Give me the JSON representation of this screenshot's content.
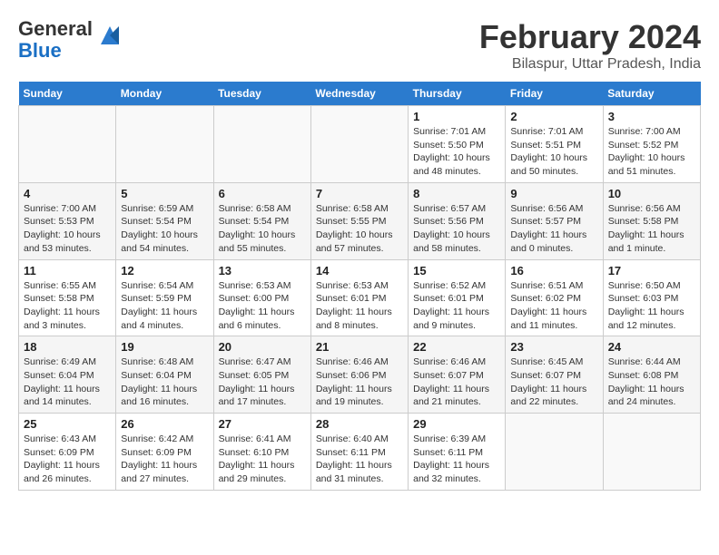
{
  "logo": {
    "line1": "General",
    "line2": "Blue"
  },
  "title": "February 2024",
  "location": "Bilaspur, Uttar Pradesh, India",
  "days_of_week": [
    "Sunday",
    "Monday",
    "Tuesday",
    "Wednesday",
    "Thursday",
    "Friday",
    "Saturday"
  ],
  "weeks": [
    [
      {
        "day": "",
        "empty": true
      },
      {
        "day": "",
        "empty": true
      },
      {
        "day": "",
        "empty": true
      },
      {
        "day": "",
        "empty": true
      },
      {
        "day": "1",
        "sunrise": "7:01 AM",
        "sunset": "5:50 PM",
        "daylight": "10 hours and 48 minutes."
      },
      {
        "day": "2",
        "sunrise": "7:01 AM",
        "sunset": "5:51 PM",
        "daylight": "10 hours and 50 minutes."
      },
      {
        "day": "3",
        "sunrise": "7:00 AM",
        "sunset": "5:52 PM",
        "daylight": "10 hours and 51 minutes."
      }
    ],
    [
      {
        "day": "4",
        "sunrise": "7:00 AM",
        "sunset": "5:53 PM",
        "daylight": "10 hours and 53 minutes."
      },
      {
        "day": "5",
        "sunrise": "6:59 AM",
        "sunset": "5:54 PM",
        "daylight": "10 hours and 54 minutes."
      },
      {
        "day": "6",
        "sunrise": "6:58 AM",
        "sunset": "5:54 PM",
        "daylight": "10 hours and 55 minutes."
      },
      {
        "day": "7",
        "sunrise": "6:58 AM",
        "sunset": "5:55 PM",
        "daylight": "10 hours and 57 minutes."
      },
      {
        "day": "8",
        "sunrise": "6:57 AM",
        "sunset": "5:56 PM",
        "daylight": "10 hours and 58 minutes."
      },
      {
        "day": "9",
        "sunrise": "6:56 AM",
        "sunset": "5:57 PM",
        "daylight": "11 hours and 0 minutes."
      },
      {
        "day": "10",
        "sunrise": "6:56 AM",
        "sunset": "5:58 PM",
        "daylight": "11 hours and 1 minute."
      }
    ],
    [
      {
        "day": "11",
        "sunrise": "6:55 AM",
        "sunset": "5:58 PM",
        "daylight": "11 hours and 3 minutes."
      },
      {
        "day": "12",
        "sunrise": "6:54 AM",
        "sunset": "5:59 PM",
        "daylight": "11 hours and 4 minutes."
      },
      {
        "day": "13",
        "sunrise": "6:53 AM",
        "sunset": "6:00 PM",
        "daylight": "11 hours and 6 minutes."
      },
      {
        "day": "14",
        "sunrise": "6:53 AM",
        "sunset": "6:01 PM",
        "daylight": "11 hours and 8 minutes."
      },
      {
        "day": "15",
        "sunrise": "6:52 AM",
        "sunset": "6:01 PM",
        "daylight": "11 hours and 9 minutes."
      },
      {
        "day": "16",
        "sunrise": "6:51 AM",
        "sunset": "6:02 PM",
        "daylight": "11 hours and 11 minutes."
      },
      {
        "day": "17",
        "sunrise": "6:50 AM",
        "sunset": "6:03 PM",
        "daylight": "11 hours and 12 minutes."
      }
    ],
    [
      {
        "day": "18",
        "sunrise": "6:49 AM",
        "sunset": "6:04 PM",
        "daylight": "11 hours and 14 minutes."
      },
      {
        "day": "19",
        "sunrise": "6:48 AM",
        "sunset": "6:04 PM",
        "daylight": "11 hours and 16 minutes."
      },
      {
        "day": "20",
        "sunrise": "6:47 AM",
        "sunset": "6:05 PM",
        "daylight": "11 hours and 17 minutes."
      },
      {
        "day": "21",
        "sunrise": "6:46 AM",
        "sunset": "6:06 PM",
        "daylight": "11 hours and 19 minutes."
      },
      {
        "day": "22",
        "sunrise": "6:46 AM",
        "sunset": "6:07 PM",
        "daylight": "11 hours and 21 minutes."
      },
      {
        "day": "23",
        "sunrise": "6:45 AM",
        "sunset": "6:07 PM",
        "daylight": "11 hours and 22 minutes."
      },
      {
        "day": "24",
        "sunrise": "6:44 AM",
        "sunset": "6:08 PM",
        "daylight": "11 hours and 24 minutes."
      }
    ],
    [
      {
        "day": "25",
        "sunrise": "6:43 AM",
        "sunset": "6:09 PM",
        "daylight": "11 hours and 26 minutes."
      },
      {
        "day": "26",
        "sunrise": "6:42 AM",
        "sunset": "6:09 PM",
        "daylight": "11 hours and 27 minutes."
      },
      {
        "day": "27",
        "sunrise": "6:41 AM",
        "sunset": "6:10 PM",
        "daylight": "11 hours and 29 minutes."
      },
      {
        "day": "28",
        "sunrise": "6:40 AM",
        "sunset": "6:11 PM",
        "daylight": "11 hours and 31 minutes."
      },
      {
        "day": "29",
        "sunrise": "6:39 AM",
        "sunset": "6:11 PM",
        "daylight": "11 hours and 32 minutes."
      },
      {
        "day": "",
        "empty": true
      },
      {
        "day": "",
        "empty": true
      }
    ]
  ]
}
